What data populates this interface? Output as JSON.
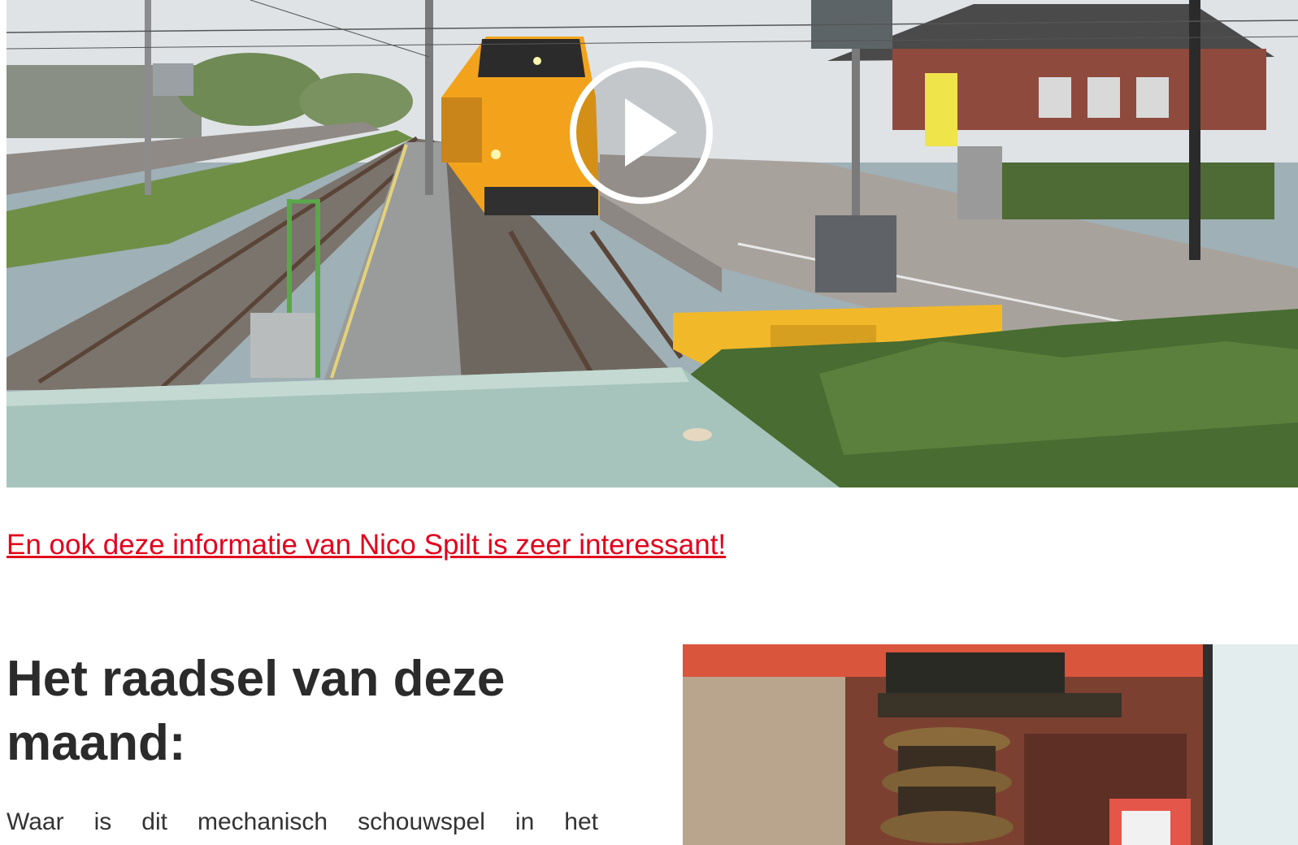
{
  "video": {
    "play_label": "Play"
  },
  "link": {
    "text": "En ook deze informatie van Nico Spilt is zeer interessant!"
  },
  "puzzle": {
    "title": "Het raadsel van deze maand:",
    "question_start": "Waar is dit mechanisch schouwspel in het"
  },
  "colors": {
    "link": "#e3001b",
    "heading": "#2b2b2b",
    "train_yellow": "#f2a31b"
  },
  "icons": {
    "play": "play-icon"
  }
}
